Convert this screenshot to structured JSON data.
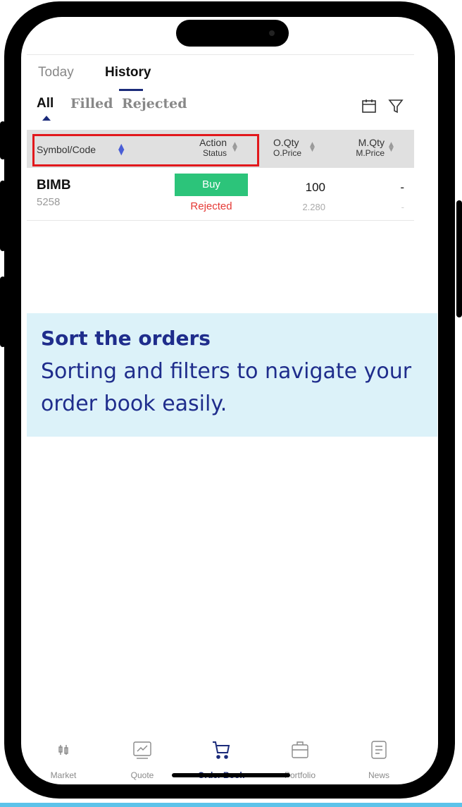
{
  "tabs": {
    "today": "Today",
    "history": "History"
  },
  "filters": {
    "all": "All",
    "filled": "Filled",
    "rejected": "Rejected"
  },
  "table": {
    "headers": {
      "symbol": "Symbol/Code",
      "action_line1": "Action",
      "action_line2": "Status",
      "oqty_line1": "O.Qty",
      "oqty_line2": "O.Price",
      "mqty_line1": "M.Qty",
      "mqty_line2": "M.Price"
    },
    "rows": [
      {
        "symbol": "BIMB",
        "code": "5258",
        "action": "Buy",
        "status": "Rejected",
        "oqty": "100",
        "oprice": "2.280",
        "mqty": "-",
        "mprice": "-"
      }
    ]
  },
  "callout": {
    "title": "Sort the orders",
    "body": "Sorting and filters to navigate your order book easily."
  },
  "nav": [
    {
      "label": "Market",
      "icon": "market-icon"
    },
    {
      "label": "Quote",
      "icon": "quote-icon"
    },
    {
      "label": "Order Book",
      "icon": "cart-icon",
      "active": true
    },
    {
      "label": "Portfolio",
      "icon": "briefcase-icon"
    },
    {
      "label": "News",
      "icon": "news-icon"
    }
  ],
  "colors": {
    "accent": "#1b2b7a",
    "buy": "#2cc47a",
    "rejected": "#e53935",
    "highlight": "#e2181c",
    "callout_bg": "#dcf2f9",
    "callout_text": "#1f2d8c"
  }
}
